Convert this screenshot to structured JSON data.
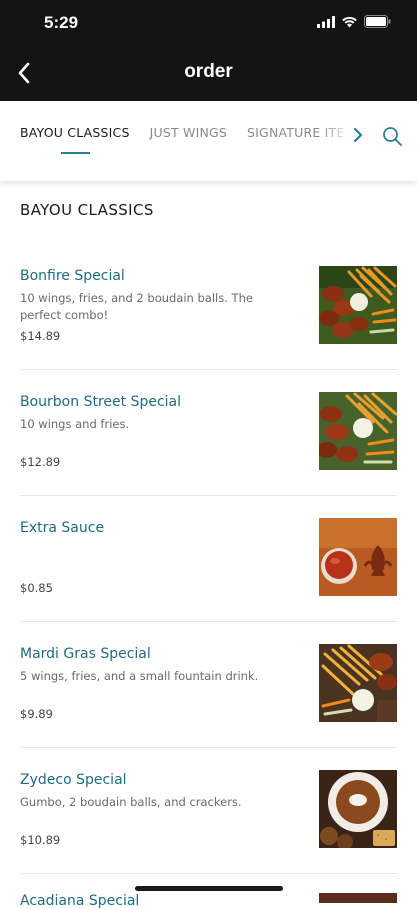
{
  "status_bar": {
    "time": "5:29"
  },
  "header": {
    "title": "order"
  },
  "tabs": [
    {
      "label": "BAYOU CLASSICS",
      "active": true
    },
    {
      "label": "JUST WINGS",
      "active": false
    },
    {
      "label": "SIGNATURE ITE",
      "active": false
    }
  ],
  "section": {
    "title": "BAYOU CLASSICS"
  },
  "menu_items": [
    {
      "name": "Bonfire Special",
      "description": "10 wings, fries, and 2 boudain balls. The perfect combo!",
      "price": "$14.89",
      "image": "wings-fries-plate"
    },
    {
      "name": "Bourbon Street Special",
      "description": "10 wings and fries.",
      "price": "$12.89",
      "image": "wings-fries-plate"
    },
    {
      "name": "Extra Sauce",
      "description": "",
      "price": "$0.85",
      "image": "sauce-cup"
    },
    {
      "name": "Mardi Gras Special",
      "description": "5 wings, fries, and a small fountain drink.",
      "price": "$9.89",
      "image": "wings-fries-drink"
    },
    {
      "name": "Zydeco Special",
      "description": "Gumbo, 2 boudain balls, and crackers.",
      "price": "$10.89",
      "image": "gumbo-bowl"
    }
  ],
  "partial_item": {
    "name": "Acadiana Special"
  },
  "colors": {
    "accent": "#2b7f93",
    "item_name": "#1f6c80",
    "header_bg": "#141414"
  }
}
